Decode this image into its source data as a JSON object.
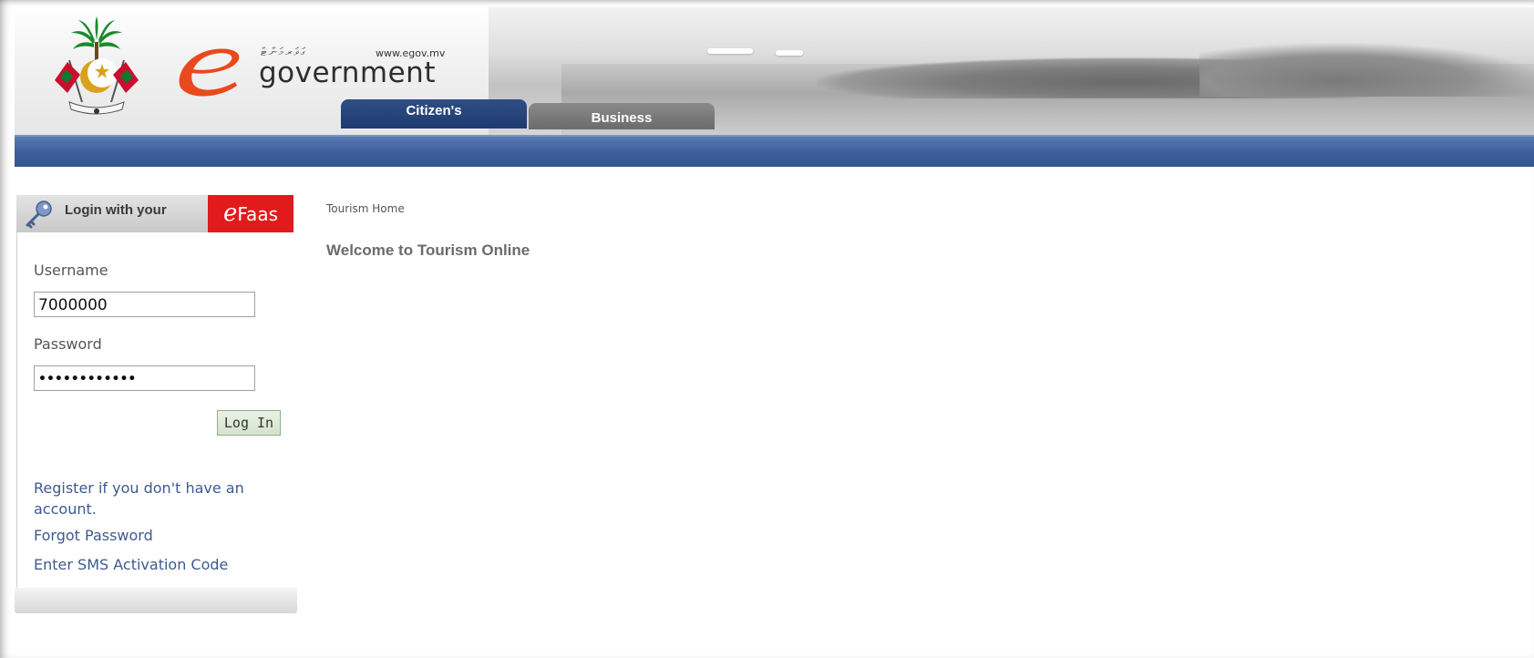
{
  "header": {
    "dhivehi_text": "ގަވަރމަންޓް",
    "site_url": "www.egov.mv",
    "brand_text": "government",
    "brand_icon": "e-logo-icon",
    "emblem_icon": "maldives-emblem-icon",
    "tabs": [
      {
        "label": "Citizen's",
        "active": true
      },
      {
        "label": "Business",
        "active": false
      }
    ],
    "colors": {
      "navbar": "#3f5f9c",
      "active_tab": "#2f4e86",
      "inactive_tab": "#7a7a7a",
      "e_logo": "#e8491d"
    }
  },
  "login": {
    "title": "Login with your",
    "efaas_prefix": "e",
    "efaas_suffix": "Faas",
    "efaas_color": "#e11b1b",
    "username_label": "Username",
    "username_value": "7000000",
    "password_label": "Password",
    "password_value": "••••••••••••",
    "login_button": "Log In",
    "links": [
      "Register if you don't have an account.",
      "Forgot Password",
      "Enter SMS Activation Code"
    ]
  },
  "main": {
    "breadcrumb": "Tourism Home",
    "title": "Welcome to Tourism Online"
  }
}
